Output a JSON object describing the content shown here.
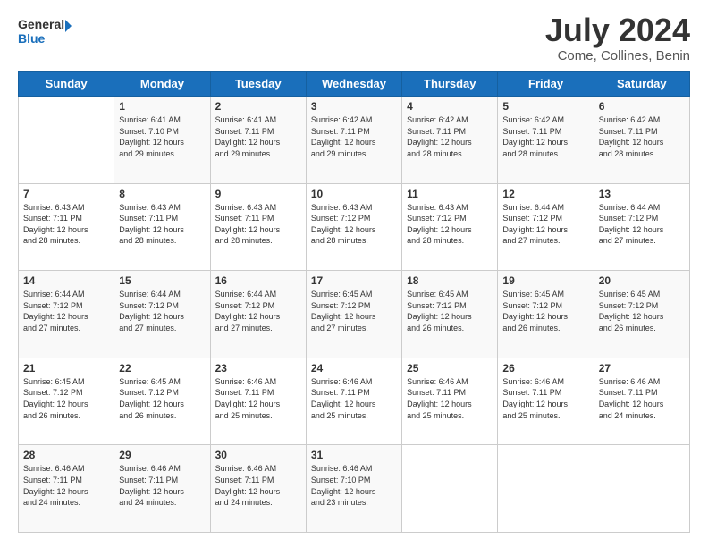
{
  "logo": {
    "line1": "General",
    "line2": "Blue"
  },
  "title": "July 2024",
  "location": "Come, Collines, Benin",
  "days_header": [
    "Sunday",
    "Monday",
    "Tuesday",
    "Wednesday",
    "Thursday",
    "Friday",
    "Saturday"
  ],
  "weeks": [
    [
      {
        "day": "",
        "info": ""
      },
      {
        "day": "1",
        "info": "Sunrise: 6:41 AM\nSunset: 7:10 PM\nDaylight: 12 hours\nand 29 minutes."
      },
      {
        "day": "2",
        "info": "Sunrise: 6:41 AM\nSunset: 7:11 PM\nDaylight: 12 hours\nand 29 minutes."
      },
      {
        "day": "3",
        "info": "Sunrise: 6:42 AM\nSunset: 7:11 PM\nDaylight: 12 hours\nand 29 minutes."
      },
      {
        "day": "4",
        "info": "Sunrise: 6:42 AM\nSunset: 7:11 PM\nDaylight: 12 hours\nand 28 minutes."
      },
      {
        "day": "5",
        "info": "Sunrise: 6:42 AM\nSunset: 7:11 PM\nDaylight: 12 hours\nand 28 minutes."
      },
      {
        "day": "6",
        "info": "Sunrise: 6:42 AM\nSunset: 7:11 PM\nDaylight: 12 hours\nand 28 minutes."
      }
    ],
    [
      {
        "day": "7",
        "info": "Sunrise: 6:43 AM\nSunset: 7:11 PM\nDaylight: 12 hours\nand 28 minutes."
      },
      {
        "day": "8",
        "info": "Sunrise: 6:43 AM\nSunset: 7:11 PM\nDaylight: 12 hours\nand 28 minutes."
      },
      {
        "day": "9",
        "info": "Sunrise: 6:43 AM\nSunset: 7:11 PM\nDaylight: 12 hours\nand 28 minutes."
      },
      {
        "day": "10",
        "info": "Sunrise: 6:43 AM\nSunset: 7:12 PM\nDaylight: 12 hours\nand 28 minutes."
      },
      {
        "day": "11",
        "info": "Sunrise: 6:43 AM\nSunset: 7:12 PM\nDaylight: 12 hours\nand 28 minutes."
      },
      {
        "day": "12",
        "info": "Sunrise: 6:44 AM\nSunset: 7:12 PM\nDaylight: 12 hours\nand 27 minutes."
      },
      {
        "day": "13",
        "info": "Sunrise: 6:44 AM\nSunset: 7:12 PM\nDaylight: 12 hours\nand 27 minutes."
      }
    ],
    [
      {
        "day": "14",
        "info": "Sunrise: 6:44 AM\nSunset: 7:12 PM\nDaylight: 12 hours\nand 27 minutes."
      },
      {
        "day": "15",
        "info": "Sunrise: 6:44 AM\nSunset: 7:12 PM\nDaylight: 12 hours\nand 27 minutes."
      },
      {
        "day": "16",
        "info": "Sunrise: 6:44 AM\nSunset: 7:12 PM\nDaylight: 12 hours\nand 27 minutes."
      },
      {
        "day": "17",
        "info": "Sunrise: 6:45 AM\nSunset: 7:12 PM\nDaylight: 12 hours\nand 27 minutes."
      },
      {
        "day": "18",
        "info": "Sunrise: 6:45 AM\nSunset: 7:12 PM\nDaylight: 12 hours\nand 26 minutes."
      },
      {
        "day": "19",
        "info": "Sunrise: 6:45 AM\nSunset: 7:12 PM\nDaylight: 12 hours\nand 26 minutes."
      },
      {
        "day": "20",
        "info": "Sunrise: 6:45 AM\nSunset: 7:12 PM\nDaylight: 12 hours\nand 26 minutes."
      }
    ],
    [
      {
        "day": "21",
        "info": "Sunrise: 6:45 AM\nSunset: 7:12 PM\nDaylight: 12 hours\nand 26 minutes."
      },
      {
        "day": "22",
        "info": "Sunrise: 6:45 AM\nSunset: 7:12 PM\nDaylight: 12 hours\nand 26 minutes."
      },
      {
        "day": "23",
        "info": "Sunrise: 6:46 AM\nSunset: 7:11 PM\nDaylight: 12 hours\nand 25 minutes."
      },
      {
        "day": "24",
        "info": "Sunrise: 6:46 AM\nSunset: 7:11 PM\nDaylight: 12 hours\nand 25 minutes."
      },
      {
        "day": "25",
        "info": "Sunrise: 6:46 AM\nSunset: 7:11 PM\nDaylight: 12 hours\nand 25 minutes."
      },
      {
        "day": "26",
        "info": "Sunrise: 6:46 AM\nSunset: 7:11 PM\nDaylight: 12 hours\nand 25 minutes."
      },
      {
        "day": "27",
        "info": "Sunrise: 6:46 AM\nSunset: 7:11 PM\nDaylight: 12 hours\nand 24 minutes."
      }
    ],
    [
      {
        "day": "28",
        "info": "Sunrise: 6:46 AM\nSunset: 7:11 PM\nDaylight: 12 hours\nand 24 minutes."
      },
      {
        "day": "29",
        "info": "Sunrise: 6:46 AM\nSunset: 7:11 PM\nDaylight: 12 hours\nand 24 minutes."
      },
      {
        "day": "30",
        "info": "Sunrise: 6:46 AM\nSunset: 7:11 PM\nDaylight: 12 hours\nand 24 minutes."
      },
      {
        "day": "31",
        "info": "Sunrise: 6:46 AM\nSunset: 7:10 PM\nDaylight: 12 hours\nand 23 minutes."
      },
      {
        "day": "",
        "info": ""
      },
      {
        "day": "",
        "info": ""
      },
      {
        "day": "",
        "info": ""
      }
    ]
  ]
}
